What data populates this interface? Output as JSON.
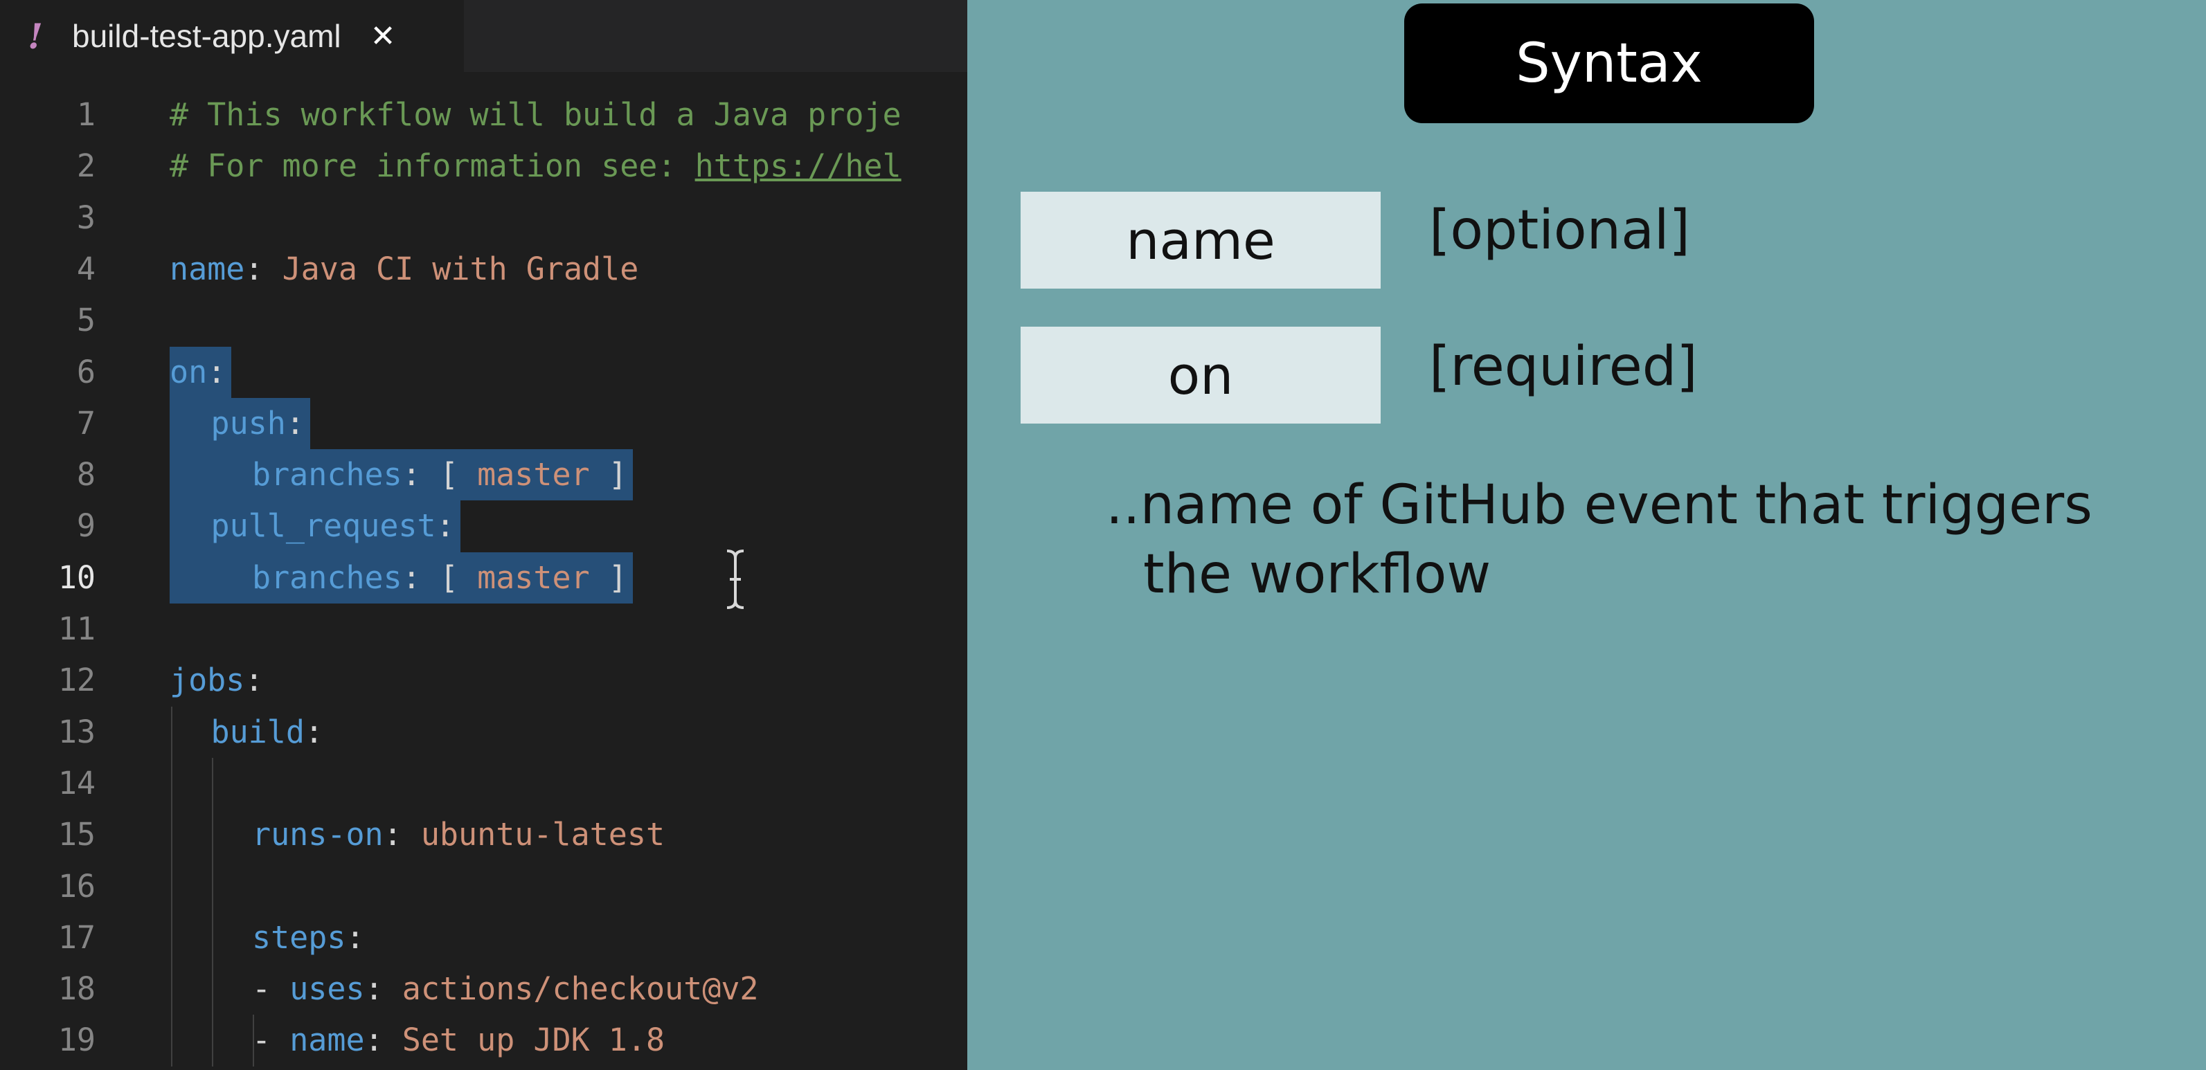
{
  "editor": {
    "tab": {
      "modified_marker": "!",
      "title": "build-test-app.yaml",
      "close": "✕"
    },
    "lines": [
      {
        "n": "1",
        "indent": 0,
        "parts": [
          {
            "t": "# This workflow will build a Java proje",
            "c": "comment"
          }
        ]
      },
      {
        "n": "2",
        "indent": 0,
        "parts": [
          {
            "t": "# For more information see: ",
            "c": "comment"
          },
          {
            "t": "https://hel",
            "c": "comment link"
          }
        ]
      },
      {
        "n": "3",
        "indent": 0,
        "parts": []
      },
      {
        "n": "4",
        "indent": 0,
        "parts": [
          {
            "t": "name",
            "c": "key"
          },
          {
            "t": ": ",
            "c": "punct"
          },
          {
            "t": "Java CI with Gradle",
            "c": "val"
          }
        ]
      },
      {
        "n": "5",
        "indent": 0,
        "parts": []
      },
      {
        "n": "6",
        "indent": 0,
        "parts": [
          {
            "t": "on",
            "c": "key"
          },
          {
            "t": ":",
            "c": "punct"
          }
        ]
      },
      {
        "n": "7",
        "indent": 1,
        "parts": [
          {
            "t": "push",
            "c": "key"
          },
          {
            "t": ":",
            "c": "punct"
          }
        ]
      },
      {
        "n": "8",
        "indent": 2,
        "parts": [
          {
            "t": "branches",
            "c": "key"
          },
          {
            "t": ": [ ",
            "c": "punct"
          },
          {
            "t": "master",
            "c": "val"
          },
          {
            "t": " ]",
            "c": "punct"
          }
        ]
      },
      {
        "n": "9",
        "indent": 1,
        "parts": [
          {
            "t": "pull_request",
            "c": "key"
          },
          {
            "t": ":",
            "c": "punct"
          }
        ]
      },
      {
        "n": "10",
        "indent": 2,
        "parts": [
          {
            "t": "branches",
            "c": "key"
          },
          {
            "t": ": [ ",
            "c": "punct"
          },
          {
            "t": "master",
            "c": "val"
          },
          {
            "t": " ]",
            "c": "punct"
          }
        ]
      },
      {
        "n": "11",
        "indent": 0,
        "parts": []
      },
      {
        "n": "12",
        "indent": 0,
        "parts": [
          {
            "t": "jobs",
            "c": "key"
          },
          {
            "t": ":",
            "c": "punct"
          }
        ]
      },
      {
        "n": "13",
        "indent": 1,
        "parts": [
          {
            "t": "build",
            "c": "key"
          },
          {
            "t": ":",
            "c": "punct"
          }
        ]
      },
      {
        "n": "14",
        "indent": 0,
        "parts": []
      },
      {
        "n": "15",
        "indent": 2,
        "parts": [
          {
            "t": "runs-on",
            "c": "key"
          },
          {
            "t": ": ",
            "c": "punct"
          },
          {
            "t": "ubuntu-latest",
            "c": "val"
          }
        ]
      },
      {
        "n": "16",
        "indent": 0,
        "parts": []
      },
      {
        "n": "17",
        "indent": 2,
        "parts": [
          {
            "t": "steps",
            "c": "key"
          },
          {
            "t": ":",
            "c": "punct"
          }
        ]
      },
      {
        "n": "18",
        "indent": 2,
        "parts": [
          {
            "t": "- ",
            "c": "punct"
          },
          {
            "t": "uses",
            "c": "key"
          },
          {
            "t": ": ",
            "c": "punct"
          },
          {
            "t": "actions/checkout@v2",
            "c": "val"
          }
        ]
      },
      {
        "n": "19",
        "indent": 2,
        "parts": [
          {
            "t": "- ",
            "c": "punct"
          },
          {
            "t": "name",
            "c": "key"
          },
          {
            "t": ": ",
            "c": "punct"
          },
          {
            "t": "Set up JDK 1.8",
            "c": "val"
          }
        ]
      }
    ],
    "active_line": "10",
    "selected_lines": [
      "6",
      "7",
      "8",
      "9",
      "10"
    ]
  },
  "slide": {
    "heading": "Syntax",
    "keywords": [
      {
        "term": "name",
        "note": "[optional]"
      },
      {
        "term": "on",
        "note": "[required]"
      }
    ],
    "description": {
      "line1": "..name of GitHub event that triggers",
      "line2": "the workflow"
    }
  },
  "colors": {
    "editor_bg": "#1e1e1e",
    "comment": "#6a9955",
    "key": "#569cd6",
    "value": "#ce9178",
    "selection": "#264f78",
    "panel_bg": "#70a4a8",
    "keyword_box_bg": "#dce8ea"
  }
}
